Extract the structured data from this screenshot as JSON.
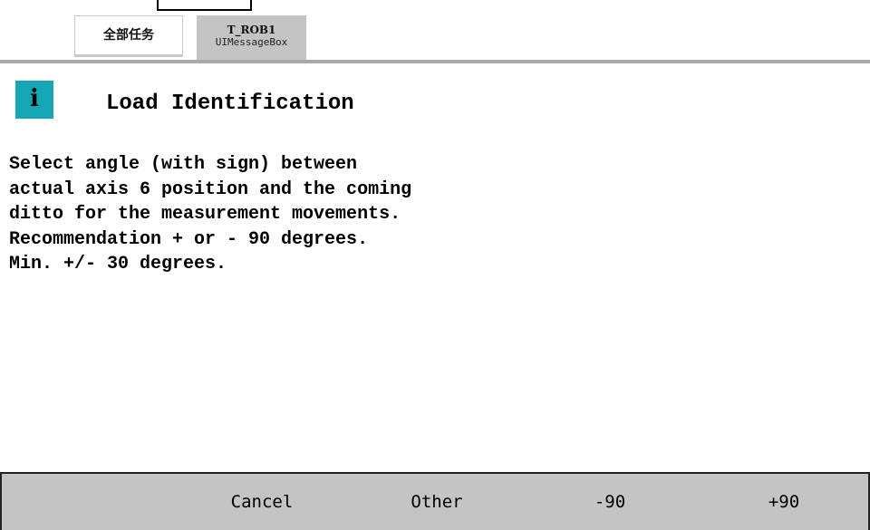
{
  "tabs": {
    "all_tasks_label": "全部任务",
    "active_title": "T_ROB1",
    "active_subtitle": "UIMessageBox"
  },
  "dialog": {
    "icon_glyph": "i",
    "title": "Load Identification",
    "message_lines": [
      "Select angle (with sign) between",
      "actual axis 6 position and the coming",
      "ditto for the measurement movements.",
      "Recommendation + or - 90 degrees.",
      "Min. +/- 30 degrees."
    ]
  },
  "buttons": {
    "cancel": "Cancel",
    "other": "Other",
    "minus90": "-90",
    "plus90": "+90"
  },
  "colors": {
    "info_icon": "#16a7b7",
    "button_bar": "#c4c4c4",
    "active_tab": "#c4c4c4"
  },
  "icons": {
    "info": "info-icon"
  }
}
